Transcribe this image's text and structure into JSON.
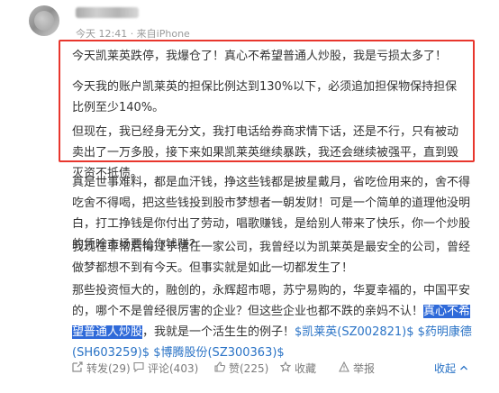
{
  "post": {
    "meta": "今天 12:41 · 来自iPhone",
    "paragraphs": {
      "p1": "今天凯莱英跌停，我爆仓了！真心不希望普通人炒股，我是亏损太多了！",
      "p2": "今天我的账户凯莱英的担保比例达到130%以下，必须追加担保物保持担保比例至少140%。",
      "p3": "但现在，我已经身无分文，我打电话给券商求情下话，还是不行，只有被动卖出了一万多股，接下来如果凯莱英继续暴跌，我还会继续被强平，直到毁灭资不抵债。",
      "p4": "真是世事难料，都是血汗钱，挣这些钱都是披星戴月，省吃俭用来的，舍不得吃舍不得喝，把这些钱投到股市梦想者一朝发财！可是一个简单的道理他没明白，打工挣钱是你付出了劳动，唱歌赚钱，是给别人带来了快乐，你一个炒股的凭啥市场要给你钱赚？",
      "p5": "我现在非常后悔过于信任一家公司，我曾经以为凯莱英是最安全的公司，曾经做梦都想不到有今天。但事实就是如此一切都发生了！",
      "p6_before": "那些投资恒大的，融创的，永辉超市嗯，苏宁易购的，华夏幸福的，中国平安的，哪个不是曾经很厉害的企业？但这些企业也都不跌的亲妈不认！",
      "p6_selected": "真心不希望普通人炒股",
      "p6_after": "，我就是一个活生生的例子！",
      "stocks": [
        "$凯莱英(SZ002821)$",
        "$药明康德(SH603259)$",
        "$博腾股份(SZ300363)$"
      ]
    }
  },
  "actions": {
    "share": "转发(29)",
    "comment": "评论(403)",
    "like": "赞(225)",
    "favorite": "收藏",
    "report": "举报",
    "collapse": "收起"
  },
  "icons": {
    "share": "share-icon",
    "comment": "comment-icon",
    "like": "thumbs-up-icon",
    "favorite": "star-icon",
    "report": "warning-icon",
    "collapse": "chevron-up-icon"
  },
  "colors": {
    "highlight_border": "#e8362d",
    "link": "#2a73c6",
    "selection": "#2f6ad9"
  }
}
